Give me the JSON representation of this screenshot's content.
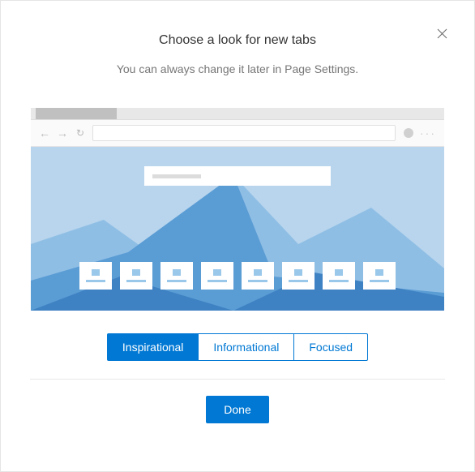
{
  "dialog": {
    "title": "Choose a look for new tabs",
    "subtitle": "You can always change it later in Page Settings."
  },
  "options": {
    "items": [
      {
        "label": "Inspirational",
        "active": true
      },
      {
        "label": "Informational",
        "active": false
      },
      {
        "label": "Focused",
        "active": false
      }
    ]
  },
  "actions": {
    "done": "Done"
  }
}
